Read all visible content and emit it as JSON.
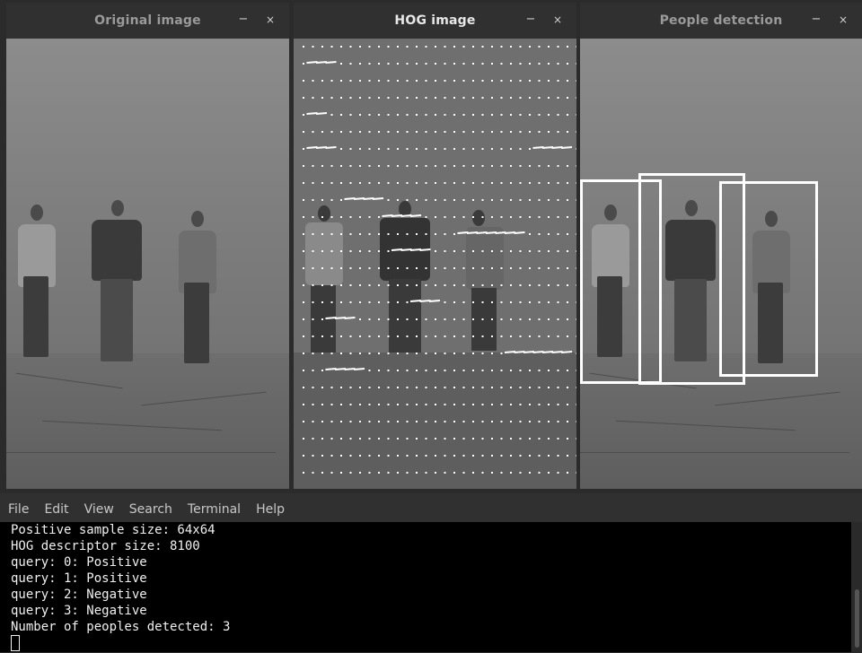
{
  "windows": {
    "original": {
      "title": "Original image",
      "min_icon": "−",
      "close_icon": "×"
    },
    "hog": {
      "title": "HOG image",
      "min_icon": "−",
      "close_icon": "×"
    },
    "detection": {
      "title": "People detection",
      "min_icon": "−",
      "close_icon": "×"
    }
  },
  "terminal": {
    "menu": [
      "File",
      "Edit",
      "View",
      "Search",
      "Terminal",
      "Help"
    ],
    "lines": [
      "Positive sample size: 64x64",
      "HOG descriptor size: 8100",
      "query: 0: Positive",
      "query: 1: Positive",
      "query: 2: Negative",
      "query: 3: Negative",
      "Number of peoples detected: 3"
    ]
  },
  "detections": {
    "count": 3
  }
}
